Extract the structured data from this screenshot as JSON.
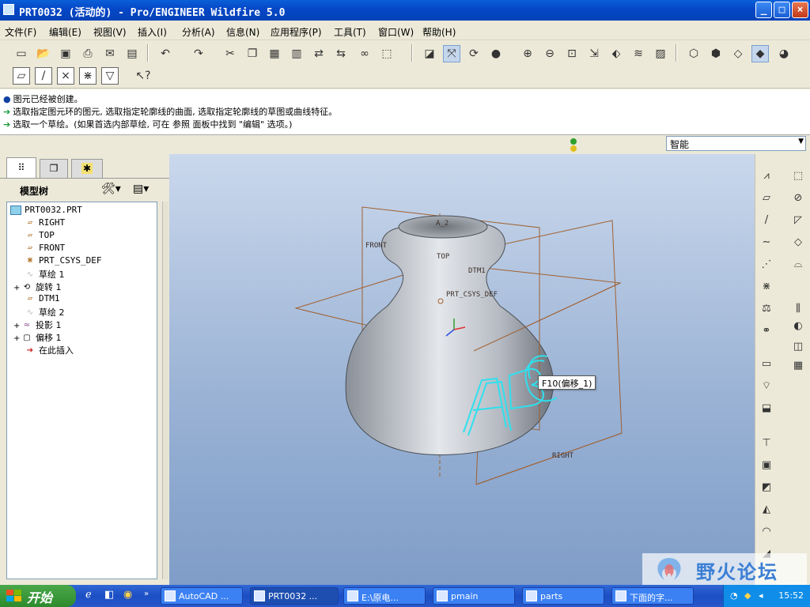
{
  "window": {
    "title": "PRT0032 (活动的) - Pro/ENGINEER Wildfire 5.0"
  },
  "menu": [
    "文件(F)",
    "编辑(E)",
    "视图(V)",
    "插入(I)",
    "分析(A)",
    "信息(N)",
    "应用程序(P)",
    "工具(T)",
    "窗口(W)",
    "帮助(H)"
  ],
  "messages": [
    "图元已经被创建。",
    "选取指定图元环的图元, 选取指定轮廓线的曲面, 选取指定轮廓线的草图或曲线特征。",
    "选取一个草绘。(如果首选内部草绘, 可在 参照 面板中找到 \"编辑\" 选项。)"
  ],
  "filter": {
    "value": "智能"
  },
  "model_tree": {
    "title": "模型树",
    "items": [
      {
        "label": "PRT0032.PRT",
        "icon": "part-icon",
        "state": "normal",
        "expand": ""
      },
      {
        "label": "RIGHT",
        "icon": "datum-plane-icon",
        "state": "normal",
        "expand": ""
      },
      {
        "label": "TOP",
        "icon": "datum-plane-icon",
        "state": "normal",
        "expand": ""
      },
      {
        "label": "FRONT",
        "icon": "datum-plane-icon",
        "state": "normal",
        "expand": ""
      },
      {
        "label": "PRT_CSYS_DEF",
        "icon": "csys-icon",
        "state": "normal",
        "expand": ""
      },
      {
        "label": "草绘 1",
        "icon": "sketch-icon",
        "state": "dim",
        "expand": ""
      },
      {
        "label": "旋转 1",
        "icon": "revolve-icon",
        "state": "normal",
        "expand": "+"
      },
      {
        "label": "DTM1",
        "icon": "datum-plane-icon",
        "state": "normal",
        "expand": ""
      },
      {
        "label": "草绘 2",
        "icon": "sketch-icon",
        "state": "dim",
        "expand": ""
      },
      {
        "label": "投影 1",
        "icon": "project-icon",
        "state": "normal",
        "expand": "+"
      },
      {
        "label": "偏移 1",
        "icon": "offset-icon",
        "state": "normal",
        "expand": "+"
      },
      {
        "label": "在此插入",
        "icon": "insert-here-icon",
        "state": "normal",
        "expand": ""
      }
    ]
  },
  "viewport": {
    "datum_labels": {
      "front": "FRONT",
      "top": "TOP",
      "dtm1": "DTM1",
      "csys": "PRT_CSYS_DEF",
      "right": "RIGHT",
      "a2": "A_2"
    },
    "tooltip": "F10(偏移_1)",
    "highlight_text": "ABC",
    "colors": {
      "datum": "#a06030",
      "highlight": "#2fe0ee",
      "body": "#c4c9d0"
    }
  },
  "taskbar": {
    "start": "开始",
    "tasks": [
      "AutoCAD ...",
      "PRT0032 ...",
      "E:\\原电...",
      "pmain",
      "parts",
      "下面的字..."
    ],
    "clock": "15:52"
  },
  "watermark": {
    "text": "野火论坛"
  }
}
